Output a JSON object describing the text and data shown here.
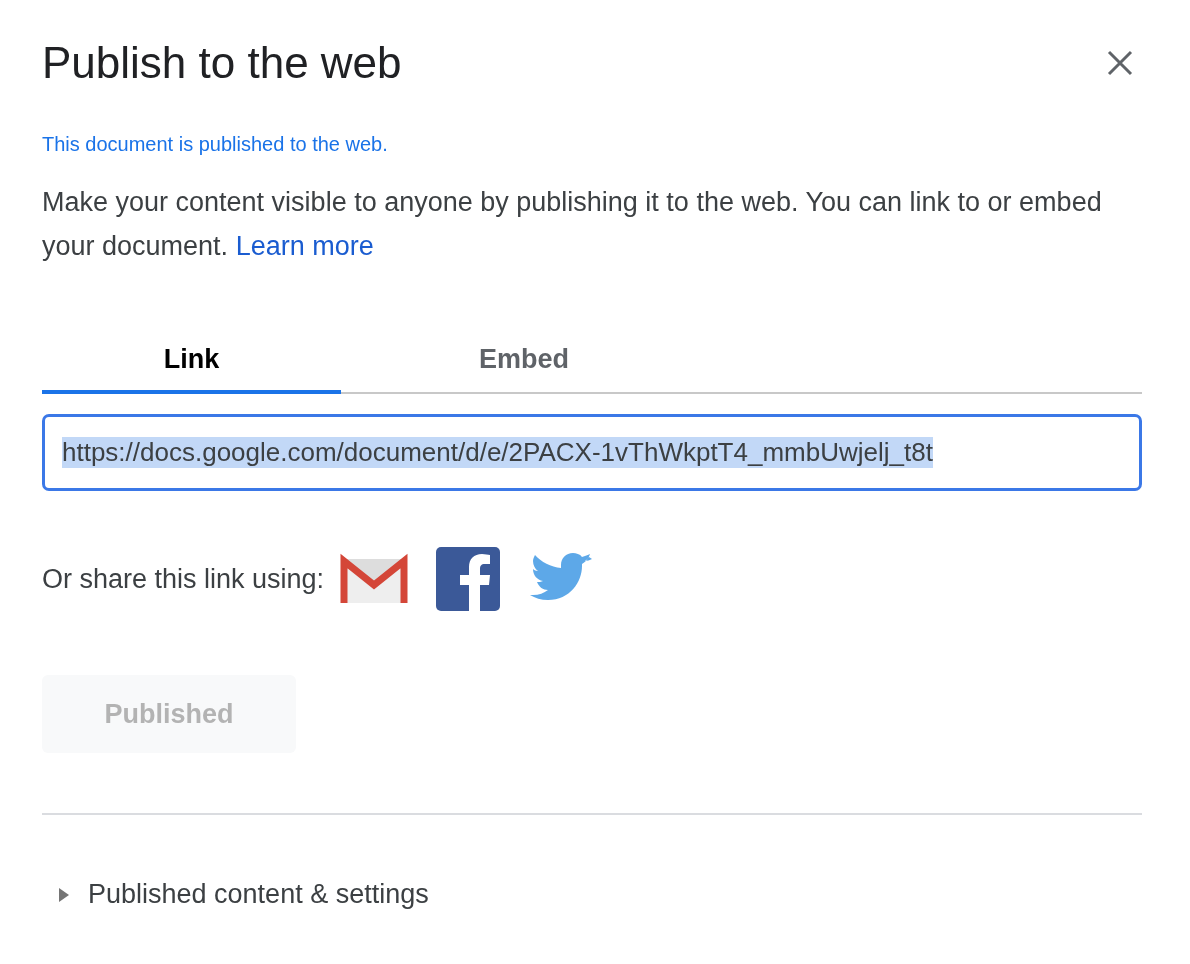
{
  "dialog": {
    "title": "Publish to the web",
    "status": "This document is published to the web.",
    "description": "Make your content visible to anyone by publishing it to the web. You can link to or embed your document.",
    "learn_more": "Learn more"
  },
  "tabs": [
    {
      "label": "Link",
      "selected": true
    },
    {
      "label": "Embed",
      "selected": false
    }
  ],
  "link_field": {
    "value": "https://docs.google.com/document/d/e/2PACX-1vThWkptT4_mmbUwjelj_t8t",
    "selected_text": true
  },
  "share": {
    "label": "Or share this link using:"
  },
  "publish_button": {
    "label": "Published",
    "disabled": true
  },
  "settings": {
    "label": "Published content & settings",
    "expanded": false
  }
}
